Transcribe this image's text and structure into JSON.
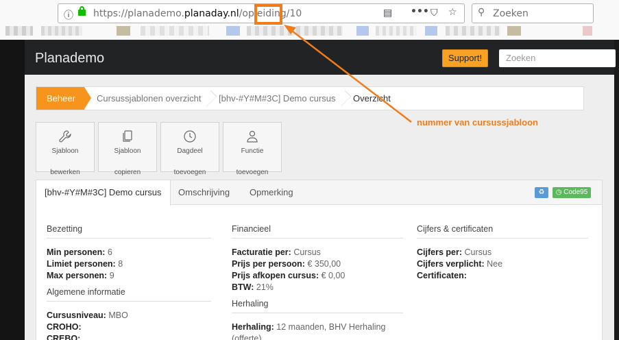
{
  "browser": {
    "url_prefix": "https://planademo.",
    "url_domain": "planaday.nl",
    "url_path": "/opleiding/10",
    "search_placeholder": "Zoeken"
  },
  "app": {
    "brand": "Planademo",
    "support_label": "Support!",
    "search_placeholder": "Zoeken"
  },
  "breadcrumb": [
    "Beheer",
    "Cursussjablonen overzicht",
    "[bhv-#Y#M#3C] Demo cursus",
    "Overzicht"
  ],
  "toolbar": [
    {
      "line1": "Sjabloon",
      "line2": "bewerken",
      "icon": "wrench-icon"
    },
    {
      "line1": "Sjabloon",
      "line2": "copieren",
      "icon": "copy-icon"
    },
    {
      "line1": "Dagdeel",
      "line2": "toevoegen",
      "icon": "clock-icon"
    },
    {
      "line1": "Functie",
      "line2": "toevoegen",
      "icon": "user-icon"
    }
  ],
  "tabs": [
    "[bhv-#Y#M#3C] Demo cursus",
    "Omschrijving",
    "Opmerking"
  ],
  "badges": {
    "code95": "Code95",
    "recycle_icon": "recycle-icon"
  },
  "bezetting": {
    "title": "Bezetting",
    "rows": [
      {
        "label": "Min personen:",
        "value": "6"
      },
      {
        "label": "Limiet personen:",
        "value": "8"
      },
      {
        "label": "Max personen:",
        "value": "9"
      }
    ]
  },
  "algemene": {
    "title": "Algemene informatie",
    "rows": [
      {
        "label": "Cursusniveau:",
        "value": "MBO"
      },
      {
        "label": "CROHO:",
        "value": ""
      },
      {
        "label": "CREBO:",
        "value": ""
      }
    ]
  },
  "financieel": {
    "title": "Financieel",
    "rows": [
      {
        "label": "Facturatie per:",
        "value": "Cursus"
      },
      {
        "label": "Prijs per persoon:",
        "value": "€ 350,00"
      },
      {
        "label": "Prijs afkopen cursus:",
        "value": "€ 0,00"
      },
      {
        "label": "BTW:",
        "value": "21%"
      }
    ]
  },
  "herhaling": {
    "title": "Herhaling",
    "label": "Herhaling:",
    "value_line1": "12 maanden, BHV Herhaling",
    "value_line2": "(offerte)"
  },
  "cijfers": {
    "title": "Cijfers & certificaten",
    "rows": [
      {
        "label": "Cijfers per:",
        "value": "Cursus"
      },
      {
        "label": "Cijfers verplicht:",
        "value": "Nee"
      },
      {
        "label": "Certificaten:",
        "value": ""
      }
    ]
  },
  "annotation": "nummer van cursussjabloon",
  "colors": {
    "accent": "#f7941d",
    "annotation": "#f07d1a",
    "topbar": "#222325"
  }
}
